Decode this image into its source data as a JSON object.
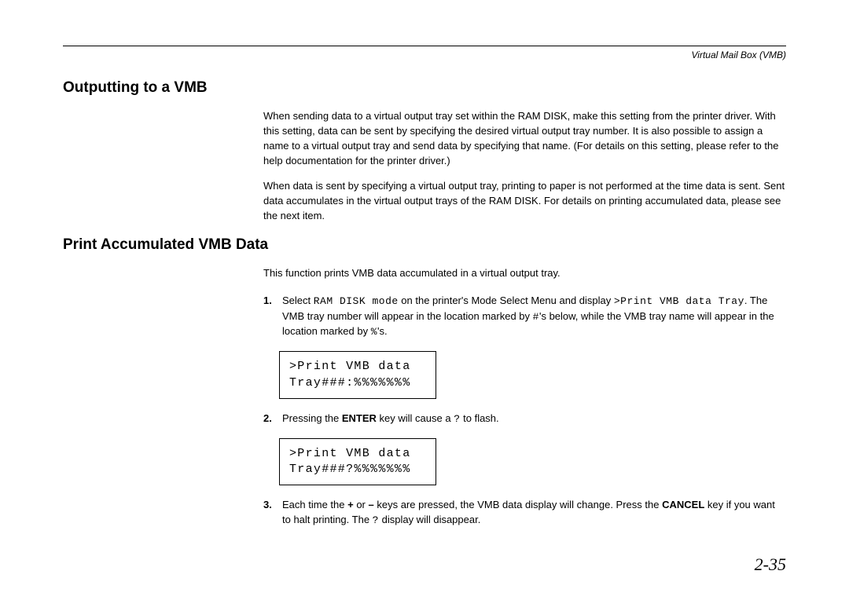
{
  "header": {
    "label": "Virtual Mail Box (VMB)"
  },
  "section1": {
    "title": "Outputting to a VMB",
    "para1": "When sending data to a virtual output tray set within the RAM DISK, make this setting from the printer driver. With this setting, data can be sent by specifying the desired virtual output tray number. It is also possible to assign a name to a virtual output tray and send data by specifying that name. (For details    on this setting, please refer to the help documentation for the printer driver.)",
    "para2": "When data is sent by specifying a virtual output tray, printing to paper is not performed at the time data  is sent. Sent data accumulates in the virtual output trays of the RAM DISK. For details on printing accumulated data, please see the next item."
  },
  "section2": {
    "title": "Print Accumulated VMB Data",
    "intro": "This function prints VMB data accumulated in a virtual output tray.",
    "step1": {
      "num": "1.",
      "pre": "Select ",
      "mono1": "RAM DISK mode",
      "mid1": " on the printer's Mode Select Menu and display ",
      "mono2": ">Print VMB data Tray",
      "mid2": ". The VMB tray number will appear in the location marked by ",
      "mono3": "#",
      "mid3": "'s below, while the VMB tray name will appear in the location marked by ",
      "mono4": "%",
      "end": "'s."
    },
    "display1": {
      "line1": ">Print VMB data",
      "line2": "Tray###:%%%%%%%"
    },
    "step2": {
      "num": "2.",
      "pre": "Pressing the ",
      "bold1": "ENTER",
      "mid": " key will cause a ",
      "mono1": "?",
      "end": " to flash."
    },
    "display2": {
      "line1": ">Print VMB data",
      "line2": "Tray###?%%%%%%%"
    },
    "step3": {
      "num": "3.",
      "pre": "Each time the ",
      "bold1": "+",
      "mid1": " or ",
      "bold2": "–",
      "mid2": " keys are pressed, the VMB data display will change. Press the ",
      "bold3": "CANCEL",
      "mid3": " key if you want to halt printing. The ",
      "mono1": "?",
      "end": " display will disappear."
    }
  },
  "pageNumber": "2-35"
}
